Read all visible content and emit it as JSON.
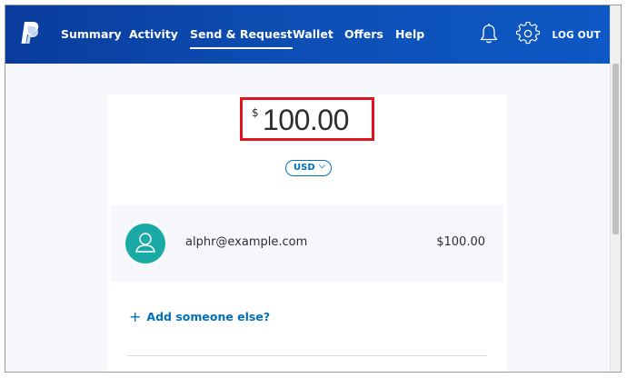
{
  "nav": {
    "items": [
      {
        "label": "Summary"
      },
      {
        "label": "Activity"
      },
      {
        "label": "Send & Request",
        "active": true
      },
      {
        "label": "Wallet"
      },
      {
        "label": "Offers"
      },
      {
        "label": "Help"
      }
    ],
    "logout_label": "LOG OUT",
    "icons": [
      "paypal-logo",
      "bell-icon",
      "gear-icon"
    ]
  },
  "amount": {
    "symbol": "$",
    "value": "100.00",
    "currency_code": "USD"
  },
  "recipient": {
    "email": "alphr@example.com",
    "amount": "$100.00"
  },
  "add_someone_label": "Add someone else?",
  "add_someone_icon": "+",
  "colors": {
    "nav_bg": "#0d4fb5",
    "accent": "#0070ba",
    "avatar": "#1aa9a4",
    "highlight_box": "#e0141e"
  }
}
